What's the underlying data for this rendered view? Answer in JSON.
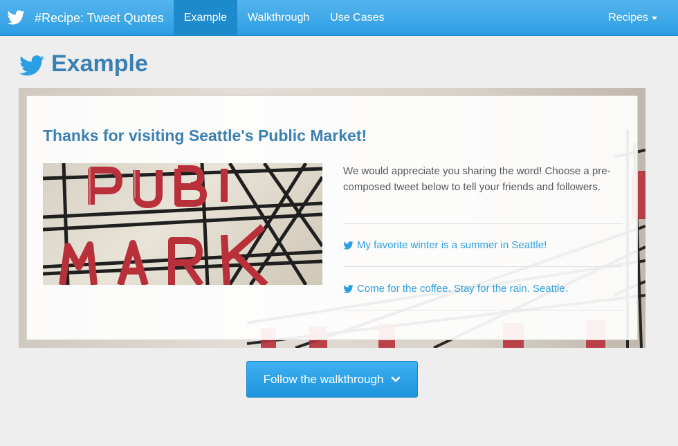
{
  "navbar": {
    "brand_title": "#Recipe: Tweet Quotes",
    "items": [
      {
        "label": "Example",
        "active": true
      },
      {
        "label": "Walkthrough",
        "active": false
      },
      {
        "label": "Use Cases",
        "active": false
      }
    ],
    "dropdown_label": "Recipes"
  },
  "page": {
    "title": "Example"
  },
  "card": {
    "title": "Thanks for visiting Seattle's Public Market!",
    "photo_sign_text": "PUBLIC MARKET",
    "intro_text": "We would appreciate you sharing the word! Choose a pre-composed tweet below to tell your friends and followers.",
    "tweets": [
      {
        "text": "My favorite winter is a summer in Seattle!"
      },
      {
        "text": "Come for the coffee. Stay for the rain. Seattle."
      }
    ]
  },
  "follow_button": {
    "label": "Follow the walkthrough"
  },
  "colors": {
    "brand_blue": "#2c9ee3",
    "nav_active": "#1d8acb",
    "title_blue": "#3a80b3",
    "sign_red": "#b8313a"
  },
  "icons": {
    "brand": "twitter-bird-icon",
    "dropdown": "caret-down-icon",
    "tweet": "twitter-bird-icon",
    "button": "chevron-down-icon"
  }
}
